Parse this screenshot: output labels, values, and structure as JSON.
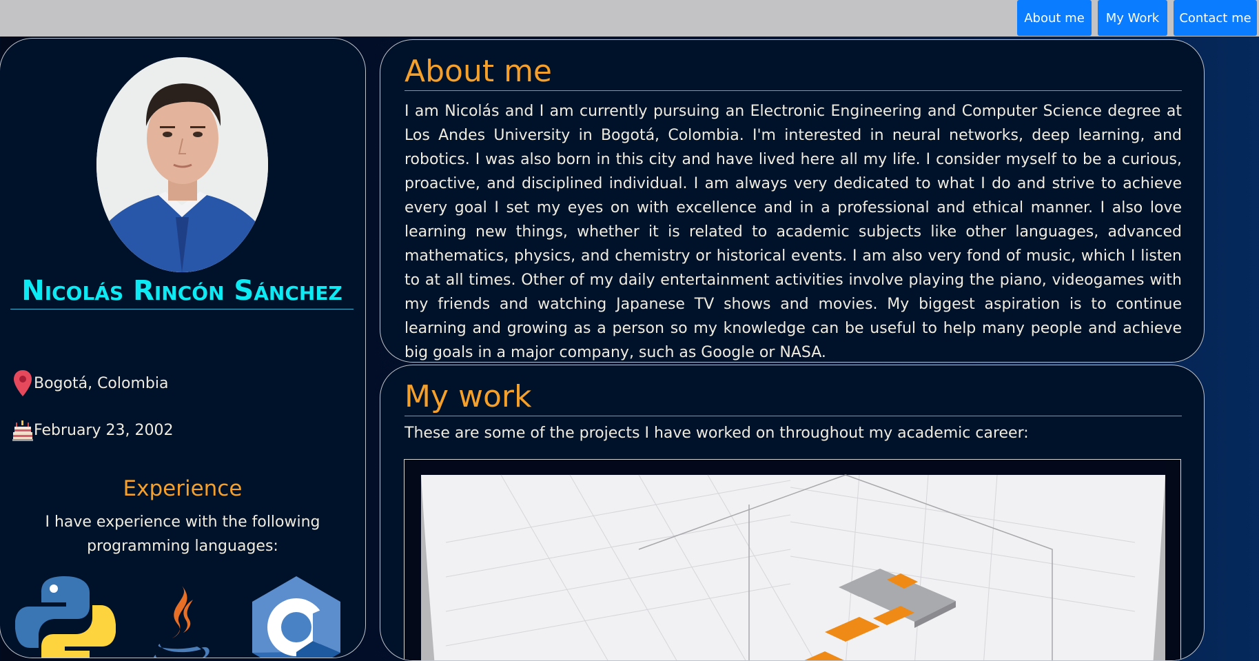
{
  "nav": {
    "items": [
      {
        "label": "About me"
      },
      {
        "label": "My Work"
      },
      {
        "label": "Contact me"
      }
    ]
  },
  "profile": {
    "name": "Nicolás Rincón Sánchez",
    "location": "Bogotá, Colombia",
    "birthday": "February 23, 2002",
    "location_icon": "map-pin-icon",
    "birthday_icon": "birthday-cake-icon"
  },
  "experience": {
    "title": "Experience",
    "description": "I have experience with the following programming languages:",
    "languages": [
      "python-logo",
      "java-logo",
      "c-logo"
    ]
  },
  "about": {
    "title": "About me",
    "text": "I am Nicolás and I am currently pursuing an Electronic Engineering and Computer Science degree at Los Andes University in Bogotá, Colombia. I'm interested in neural networks, deep learning, and robotics. I was also born in this city and have lived here all my life. I consider myself to be a curious, proactive, and disciplined individual. I am always very dedicated to what I do and strive to achieve every goal I set my eyes on with excellence and in a professional and ethical manner. I also love learning new things, whether it is related to academic subjects like other languages, advanced mathematics, physics, and chemistry or historical events. I am also very fond of music, which I listen to at all times. Other of my daily entertainment activities involve playing the piano, videogames with my friends and watching Japanese TV shows and movies. My biggest aspiration is to continue learning and growing as a person so my knowledge can be useful to help many people and achieve big goals in a major company, such as Google or NASA."
  },
  "work": {
    "title": "My work",
    "intro": "These are some of the projects I have worked on throughout my academic career:"
  },
  "colors": {
    "accent": "#f5a02b",
    "name": "#0eeaf4",
    "nav_button": "#0a7cff",
    "card_bg": "#00112a"
  }
}
